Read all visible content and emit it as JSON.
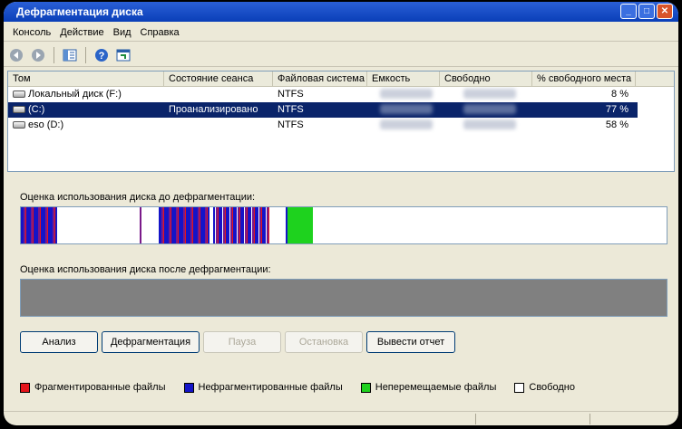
{
  "window": {
    "title": "Дефрагментация диска"
  },
  "menu": [
    "Консоль",
    "Действие",
    "Вид",
    "Справка"
  ],
  "volumes": {
    "columns": [
      "Том",
      "Состояние сеанса",
      "Файловая система",
      "Емкость",
      "Свободно",
      "% свободного места"
    ],
    "rows": [
      {
        "name": "Локальный диск (F:)",
        "status": "",
        "fs": "NTFS",
        "capacity": "",
        "free": "",
        "pct": "8 %",
        "selected": false
      },
      {
        "name": "(C:)",
        "status": "Проанализировано",
        "fs": "NTFS",
        "capacity": "",
        "free": "",
        "pct": "77 %",
        "selected": true
      },
      {
        "name": "eso (D:)",
        "status": "",
        "fs": "NTFS",
        "capacity": "",
        "free": "",
        "pct": "58 %",
        "selected": false
      }
    ]
  },
  "before_label": "Оценка использования диска до дефрагментации:",
  "after_label": "Оценка использования диска после дефрагментации:",
  "buttons": {
    "analyze": "Анализ",
    "defrag": "Дефрагментация",
    "pause": "Пауза",
    "stop": "Остановка",
    "report": "Вывести отчет"
  },
  "legend": [
    {
      "label": "Фрагментированные файлы",
      "color": "#e4141b"
    },
    {
      "label": "Нефрагментированные файлы",
      "color": "#1414c8"
    },
    {
      "label": "Неперемещаемые файлы",
      "color": "#1ed21e"
    },
    {
      "label": "Свободно",
      "color": "#ffffff"
    }
  ],
  "colors": {
    "fragmented": "#e4141b",
    "contiguous": "#1414c8",
    "unmovable": "#1ed21e",
    "free": "#ffffff",
    "selection": "#0a246a"
  }
}
